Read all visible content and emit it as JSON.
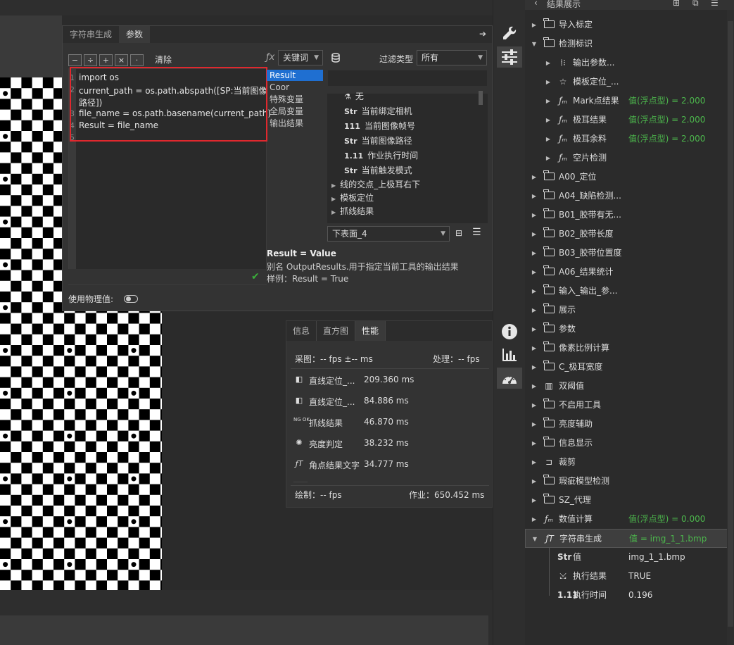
{
  "code_panel": {
    "tabs": [
      "字符串生成",
      "参数"
    ],
    "ops": [
      "−",
      "÷",
      "+",
      "×",
      "·"
    ],
    "clear": "清除",
    "code_lines": [
      {
        "n": "1",
        "text": "import os"
      },
      {
        "n": "2",
        "text": "current_path = os.path.abspath([SP:当前图像"
      },
      {
        "n": "",
        "text": "路径])"
      },
      {
        "n": "3",
        "text": "file_name = os.path.basename(current_path)"
      },
      {
        "n": "4",
        "text": "Result = file_name"
      },
      {
        "n": "5",
        "text": ""
      }
    ],
    "physical_label": "使用物理值:"
  },
  "keyword": {
    "select": "关键词",
    "items": [
      "Result",
      "Coor",
      "特殊变量",
      "全局变量",
      "输出结果"
    ],
    "filter_label": "过滤类型",
    "filter_value": "所有",
    "tree": [
      {
        "icon": "⚗",
        "label": "无",
        "indent": 1
      },
      {
        "icon": "Str",
        "label": "当前绑定相机",
        "indent": 1
      },
      {
        "icon": "111",
        "label": "当前图像帧号",
        "indent": 1
      },
      {
        "icon": "Str",
        "label": "当前图像路径",
        "indent": 1
      },
      {
        "icon": "1.11",
        "label": "作业执行时间",
        "indent": 1
      },
      {
        "icon": "Str",
        "label": "当前触发模式",
        "indent": 1
      },
      {
        "icon": "▶",
        "label": "线的交点_上极耳右下",
        "indent": 0
      },
      {
        "icon": "▶",
        "label": "模板定位",
        "indent": 0
      },
      {
        "icon": "▶",
        "label": "抓线结果",
        "indent": 0
      }
    ],
    "surface_select": "下表面_4",
    "desc_title": "Result = Value",
    "desc_line1": "别名 OutputResults.用于指定当前工具的输出结果",
    "desc_line2": "样例：Result = True"
  },
  "info_panel": {
    "tabs": [
      "信息",
      "直方图",
      "性能"
    ],
    "capture": "采图：-- fps  ±-- ms",
    "process": "处理：-- fps",
    "rows": [
      {
        "icon": "◧",
        "name": "直线定位_...",
        "value": "209.360 ms"
      },
      {
        "icon": "◧",
        "name": "直线定位_...",
        "value": "84.886 ms"
      },
      {
        "icon": "NG OK",
        "name": "抓线结果",
        "value": "46.870 ms"
      },
      {
        "icon": "✺",
        "name": "亮度判定",
        "value": "38.232 ms"
      },
      {
        "icon": "ƒT",
        "name": "角点结果文字",
        "value": "34.777 ms"
      }
    ],
    "draw": "绘制：-- fps",
    "job": "作业：650.452  ms"
  },
  "right_tree": {
    "title": "结果展示",
    "rows": [
      {
        "exp": "▶",
        "indent": 0,
        "icon": "folder",
        "label": "导入标定"
      },
      {
        "exp": "▼",
        "indent": 0,
        "icon": "folder",
        "label": "检测标识"
      },
      {
        "exp": "▶",
        "indent": 1,
        "icon": "⁞⁝",
        "label": "输出参数..."
      },
      {
        "exp": "▶",
        "indent": 1,
        "icon": "☆",
        "label": "模板定位_..."
      },
      {
        "exp": "▶",
        "indent": 1,
        "icon": "ƒₘ",
        "label": "Mark点结果",
        "value": "值(浮点型) = 2.000"
      },
      {
        "exp": "▶",
        "indent": 1,
        "icon": "ƒₘ",
        "label": "极耳结果",
        "value": "值(浮点型) = 2.000"
      },
      {
        "exp": "▶",
        "indent": 1,
        "icon": "ƒₘ",
        "label": "极耳余料",
        "value": "值(浮点型) = 2.000"
      },
      {
        "exp": "▶",
        "indent": 1,
        "icon": "ƒₘ",
        "label": "空片检测"
      },
      {
        "exp": "▶",
        "indent": 0,
        "icon": "folder",
        "label": "A00_定位"
      },
      {
        "exp": "▶",
        "indent": 0,
        "icon": "folder",
        "label": "A04_缺陷检测..."
      },
      {
        "exp": "▶",
        "indent": 0,
        "icon": "folder",
        "label": "B01_胶带有无..."
      },
      {
        "exp": "▶",
        "indent": 0,
        "icon": "folder",
        "label": "B02_胶带长度"
      },
      {
        "exp": "▶",
        "indent": 0,
        "icon": "folder",
        "label": "B03_胶带位置度"
      },
      {
        "exp": "▶",
        "indent": 0,
        "icon": "folder",
        "label": "A06_结果统计"
      },
      {
        "exp": "▶",
        "indent": 0,
        "icon": "folder",
        "label": "输入_输出_参..."
      },
      {
        "exp": "▶",
        "indent": 0,
        "icon": "folder",
        "label": "展示"
      },
      {
        "exp": "▶",
        "indent": 0,
        "icon": "folder",
        "label": "参数"
      },
      {
        "exp": "▶",
        "indent": 0,
        "icon": "folder",
        "label": "像素比例计算"
      },
      {
        "exp": "▶",
        "indent": 0,
        "icon": "folder",
        "label": "C_极耳宽度"
      },
      {
        "exp": "▶",
        "indent": 0,
        "icon": "▥",
        "label": "双阈值"
      },
      {
        "exp": "▶",
        "indent": 0,
        "icon": "folder",
        "label": "不启用工具"
      },
      {
        "exp": "▶",
        "indent": 0,
        "icon": "folder",
        "label": "亮度辅助"
      },
      {
        "exp": "▶",
        "indent": 0,
        "icon": "folder",
        "label": "信息显示"
      },
      {
        "exp": "▶",
        "indent": 0,
        "icon": "⊐",
        "label": "裁剪"
      },
      {
        "exp": "▶",
        "indent": 0,
        "icon": "folder",
        "label": "瑕疵模型检测"
      },
      {
        "exp": "▶",
        "indent": 0,
        "icon": "folder",
        "label": "SZ_代理"
      },
      {
        "exp": "▶",
        "indent": 0,
        "icon": "ƒₘ",
        "label": "数值计算",
        "value": "值(浮点型) = 0.000"
      },
      {
        "exp": "▼",
        "indent": 0,
        "icon": "ƒT",
        "label": "字符串生成",
        "value": "值 = img_1_1.bmp",
        "selected": true
      },
      {
        "exp": "",
        "indent": 1,
        "icon": "Str",
        "label": "值",
        "value2": "img_1_1.bmp"
      },
      {
        "exp": "",
        "indent": 1,
        "icon": "⤩",
        "label": "执行结果",
        "value2": "TRUE"
      },
      {
        "exp": "",
        "indent": 1,
        "icon": "1.11",
        "label": "执行时间",
        "value2": "0.196"
      }
    ]
  }
}
